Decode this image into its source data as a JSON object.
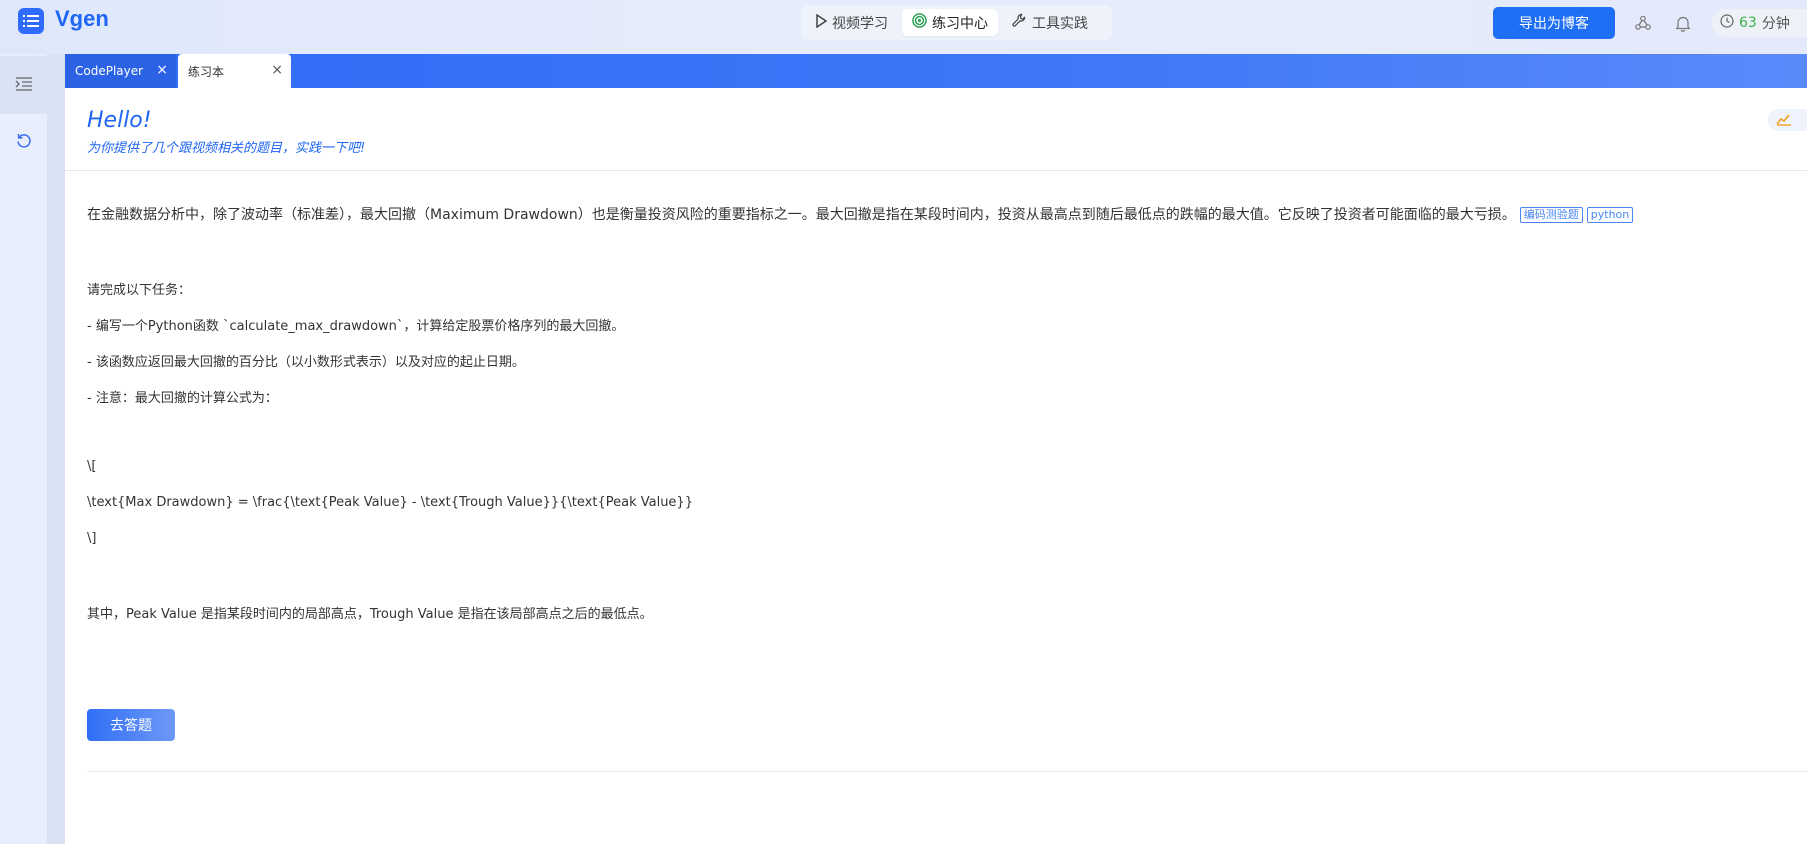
{
  "app": {
    "name": "Vgen",
    "accent": "#1f66f5"
  },
  "header": {
    "mode_tabs": [
      {
        "label": "视频学习",
        "icon": "play-icon"
      },
      {
        "label": "练习中心",
        "icon": "target-icon",
        "active": true
      },
      {
        "label": "工具实践",
        "icon": "wrench-icon"
      }
    ],
    "export_label": "导出为博客",
    "timer_value": "63",
    "timer_unit": "分钟"
  },
  "sidebar": {
    "items": [
      {
        "icon": "indent-list-icon",
        "active": true
      },
      {
        "icon": "refresh-icon",
        "active": false
      }
    ]
  },
  "tabs": [
    {
      "label": "CodePlayer",
      "active": false
    },
    {
      "label": "练习本",
      "active": true
    }
  ],
  "content": {
    "hello": "Hello!",
    "subtitle": "为你提供了几个跟视频相关的题目，实践一下吧!",
    "intro": "在金融数据分析中，除了波动率（标准差），最大回撤（Maximum Drawdown）也是衡量投资风险的重要指标之一。最大回撤是指在某段时间内，投资从最高点到随后最低点的跌幅的最大值。它反映了投资者可能面临的最大亏损。",
    "tags": [
      "编码测验题",
      "python"
    ],
    "lines": [
      "请完成以下任务：",
      "- 编写一个Python函数 `calculate_max_drawdown`，计算给定股票价格序列的最大回撤。",
      "- 该函数应返回最大回撤的百分比（以小数形式表示）以及对应的起止日期。",
      "- 注意：最大回撤的计算公式为：",
      "\\[",
      "\\text{Max Drawdown} = \\frac{\\text{Peak Value} - \\text{Trough Value}}{\\text{Peak Value}}",
      "\\]",
      "其中，Peak Value 是指某段时间内的局部高点，Trough Value 是指在该局部高点之后的最低点。"
    ],
    "answer_label": "去答题"
  }
}
